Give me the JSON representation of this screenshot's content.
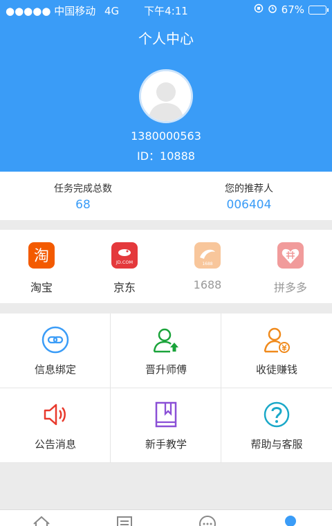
{
  "status_bar": {
    "carrier": "●●●●● 中国移动",
    "network": "4G",
    "time": "下午4:11",
    "battery_text": "67%",
    "battery_level": 0.67
  },
  "header": {
    "title": "个人中心",
    "phone": "1380000563",
    "user_id": "ID：10888"
  },
  "stats": {
    "tasks_label": "任务完成总数",
    "tasks_value": "68",
    "referrer_label": "您的推荐人",
    "referrer_value": "006404"
  },
  "platforms": [
    {
      "label": "淘宝",
      "icon": "taobao-icon",
      "color": "#f35a00",
      "glyph": "淘"
    },
    {
      "label": "京东",
      "icon": "jd-icon",
      "color": "#e4393c",
      "glyph": "JD.COM"
    },
    {
      "label": "1688",
      "icon": "alibaba-1688-icon",
      "color": "#f5a15a",
      "glyph": "1688"
    },
    {
      "label": "拼多多",
      "icon": "pinduoduo-icon",
      "color": "#e85a5a"
    }
  ],
  "menu": [
    {
      "label": "信息绑定",
      "icon": "link-icon",
      "color": "#3a9cf7"
    },
    {
      "label": "晋升师傅",
      "icon": "user-upgrade-icon",
      "color": "#1aa33a"
    },
    {
      "label": "收徒赚钱",
      "icon": "user-money-icon",
      "color": "#f08a1c"
    },
    {
      "label": "公告消息",
      "icon": "speaker-icon",
      "color": "#e8392c"
    },
    {
      "label": "新手教学",
      "icon": "book-icon",
      "color": "#8a4fd6"
    },
    {
      "label": "帮助与客服",
      "icon": "help-icon",
      "color": "#1aa8c8"
    }
  ],
  "tabbar": {
    "tabs": [
      {
        "icon": "home-icon"
      },
      {
        "icon": "task-list-icon"
      },
      {
        "icon": "chat-icon"
      },
      {
        "icon": "profile-icon",
        "active": true
      }
    ]
  },
  "colors": {
    "accent": "#3a9cf7"
  }
}
